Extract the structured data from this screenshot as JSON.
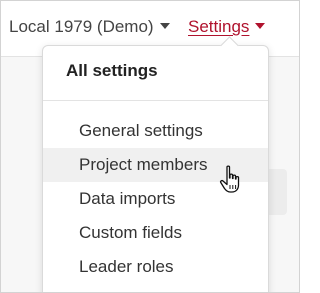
{
  "topbar": {
    "project_label": "Local 1979 (Demo)",
    "settings_label": "Settings"
  },
  "menu": {
    "header": "All settings",
    "items": [
      {
        "label": "General settings"
      },
      {
        "label": "Project members"
      },
      {
        "label": "Data imports"
      },
      {
        "label": "Custom fields"
      },
      {
        "label": "Leader roles"
      }
    ],
    "hovered_item": "Project members"
  },
  "colors": {
    "accent": "#b0122d",
    "hover_bg": "#f0f0f0"
  }
}
